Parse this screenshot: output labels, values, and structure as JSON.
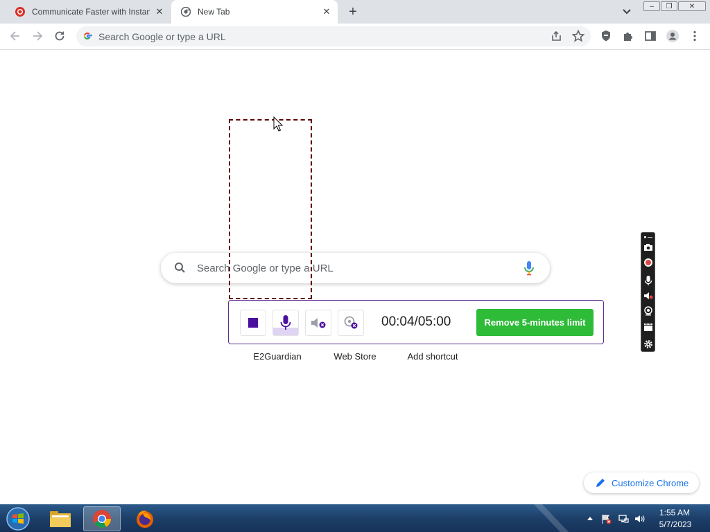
{
  "browser": {
    "tabs": [
      {
        "title": "Communicate Faster with Instant",
        "active": false
      },
      {
        "title": "New Tab",
        "active": true
      }
    ],
    "omnibox_placeholder": "Search Google or type a URL"
  },
  "newtab": {
    "search_placeholder": "Search Google or type a URL",
    "shortcuts": [
      "E2Guardian",
      "Web Store",
      "Add shortcut"
    ],
    "customize_label": "Customize Chrome"
  },
  "recorder": {
    "timer": "00:04/05:00",
    "limit_button": "Remove 5-minutes limit"
  },
  "taskbar": {
    "time": "1:55 AM",
    "date": "5/7/2023"
  },
  "colors": {
    "accent_green": "#2dbb38",
    "recorder_purple": "#5b2c91",
    "google_blue": "#1a73e8"
  }
}
